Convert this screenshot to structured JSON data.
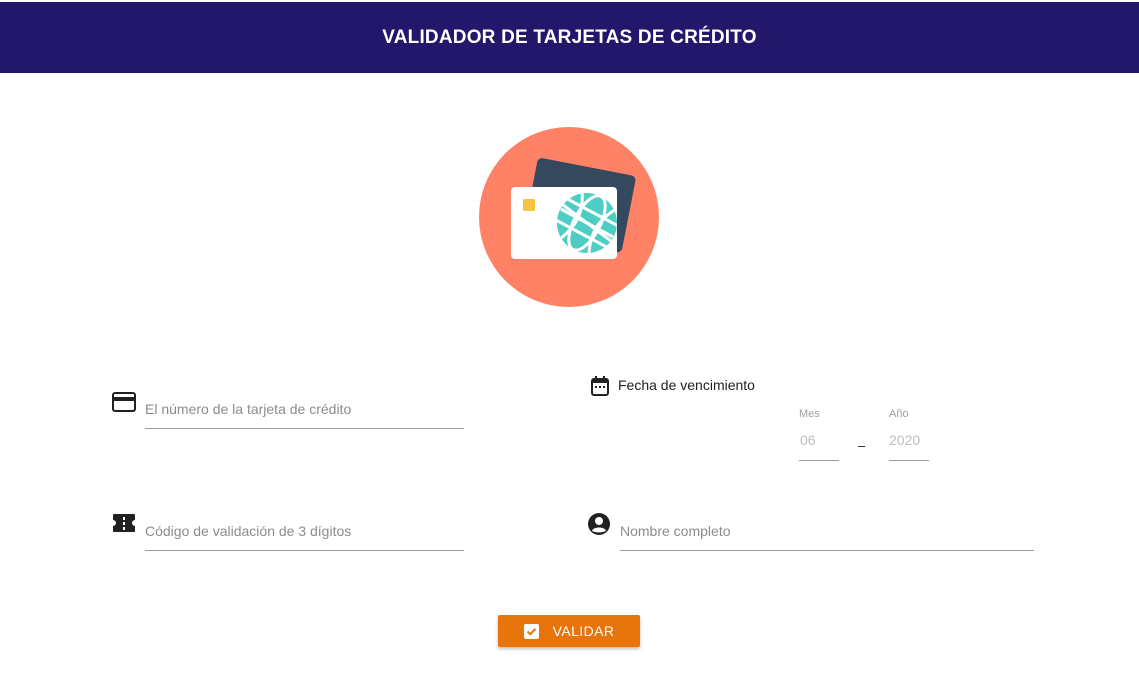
{
  "header": {
    "title": "VALIDADOR DE TARJETAS DE CRÉDITO"
  },
  "hero": {
    "icon": "credit-card-globe-illustration"
  },
  "form": {
    "card_number": {
      "placeholder": "El número de la tarjeta de crédito",
      "value": "",
      "icon": "credit-card-icon"
    },
    "expiry": {
      "title": "Fecha de vencimiento",
      "icon": "calendar-icon",
      "month": {
        "label": "Mes",
        "placeholder": "06"
      },
      "year": {
        "label": "Año",
        "placeholder": "2020"
      },
      "separator": "-"
    },
    "cvv": {
      "placeholder": "Código de validación de 3 dígitos",
      "value": "",
      "icon": "ticket-icon"
    },
    "name": {
      "placeholder": "Nombre completo",
      "value": "",
      "icon": "account-circle-icon"
    }
  },
  "actions": {
    "validate_label": "VALIDAR",
    "validate_icon": "checkbox-icon"
  },
  "colors": {
    "header_bg": "#22176a",
    "button_bg": "#e8740c",
    "hero_circle": "#ff8266",
    "card_back": "#34495e",
    "card_front": "#ffffff",
    "globe": "#4ecdc4",
    "chip": "#f6c344"
  }
}
